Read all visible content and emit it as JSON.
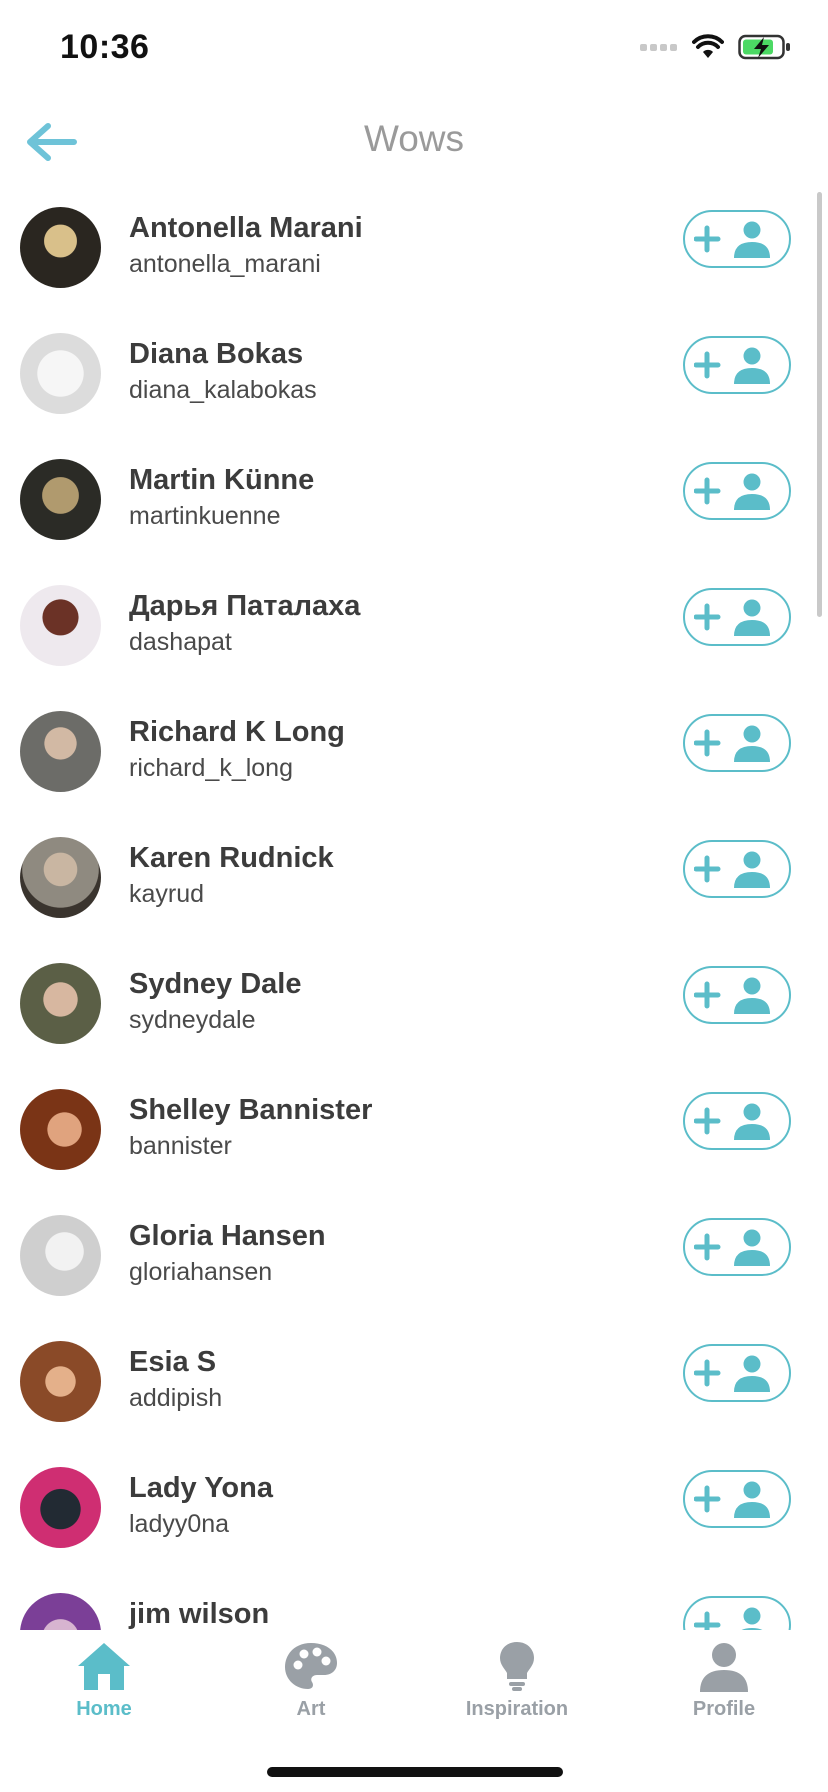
{
  "status_bar": {
    "time": "10:36"
  },
  "header": {
    "title": "Wows"
  },
  "colors": {
    "accent": "#5bbdc9",
    "inactive_tab": "#9aa0a6"
  },
  "users": [
    {
      "name": "Antonella Marani",
      "username": "antonella_marani"
    },
    {
      "name": "Diana Bokas",
      "username": "diana_kalabokas"
    },
    {
      "name": "Martin Künne",
      "username": "martinkuenne"
    },
    {
      "name": "Дарья Паталаха",
      "username": "dashapat"
    },
    {
      "name": "Richard K Long",
      "username": "richard_k_long"
    },
    {
      "name": "Karen Rudnick",
      "username": "kayrud"
    },
    {
      "name": "Sydney Dale",
      "username": "sydneydale"
    },
    {
      "name": "Shelley Bannister",
      "username": "bannister"
    },
    {
      "name": "Gloria Hansen",
      "username": "gloriahansen"
    },
    {
      "name": "Esia S",
      "username": "addipish"
    },
    {
      "name": "Lady Yona",
      "username": "ladyy0na"
    },
    {
      "name": "jim wilson",
      "username": ""
    }
  ],
  "tabs": [
    {
      "label": "Home",
      "icon": "home-icon",
      "active": true
    },
    {
      "label": "Art",
      "icon": "palette-icon",
      "active": false
    },
    {
      "label": "Inspiration",
      "icon": "lightbulb-icon",
      "active": false
    },
    {
      "label": "Profile",
      "icon": "person-icon",
      "active": false
    }
  ]
}
